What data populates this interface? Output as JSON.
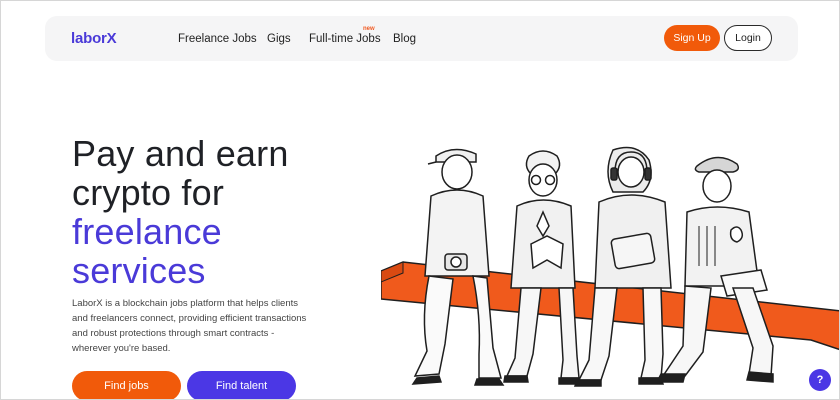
{
  "nav": {
    "logo": "laborX",
    "links": [
      "Freelance Jobs",
      "Gigs",
      "Full-time Jobs",
      "Blog"
    ],
    "new_badge": "new",
    "signup": "Sign Up",
    "login": "Login"
  },
  "hero": {
    "title_line1": "Pay and earn",
    "title_line2": "crypto for",
    "title_line3": "freelance",
    "title_line4": "services",
    "description": "LaborX is a blockchain jobs platform that helps clients and freelancers connect, providing efficient transactions and robust protections through smart contracts - wherever you're based.",
    "find_jobs": "Find jobs",
    "find_talent": "Find talent"
  },
  "help": {
    "label": "?"
  },
  "colors": {
    "brand": "#4a3ad8",
    "accent": "#f15a0a"
  }
}
